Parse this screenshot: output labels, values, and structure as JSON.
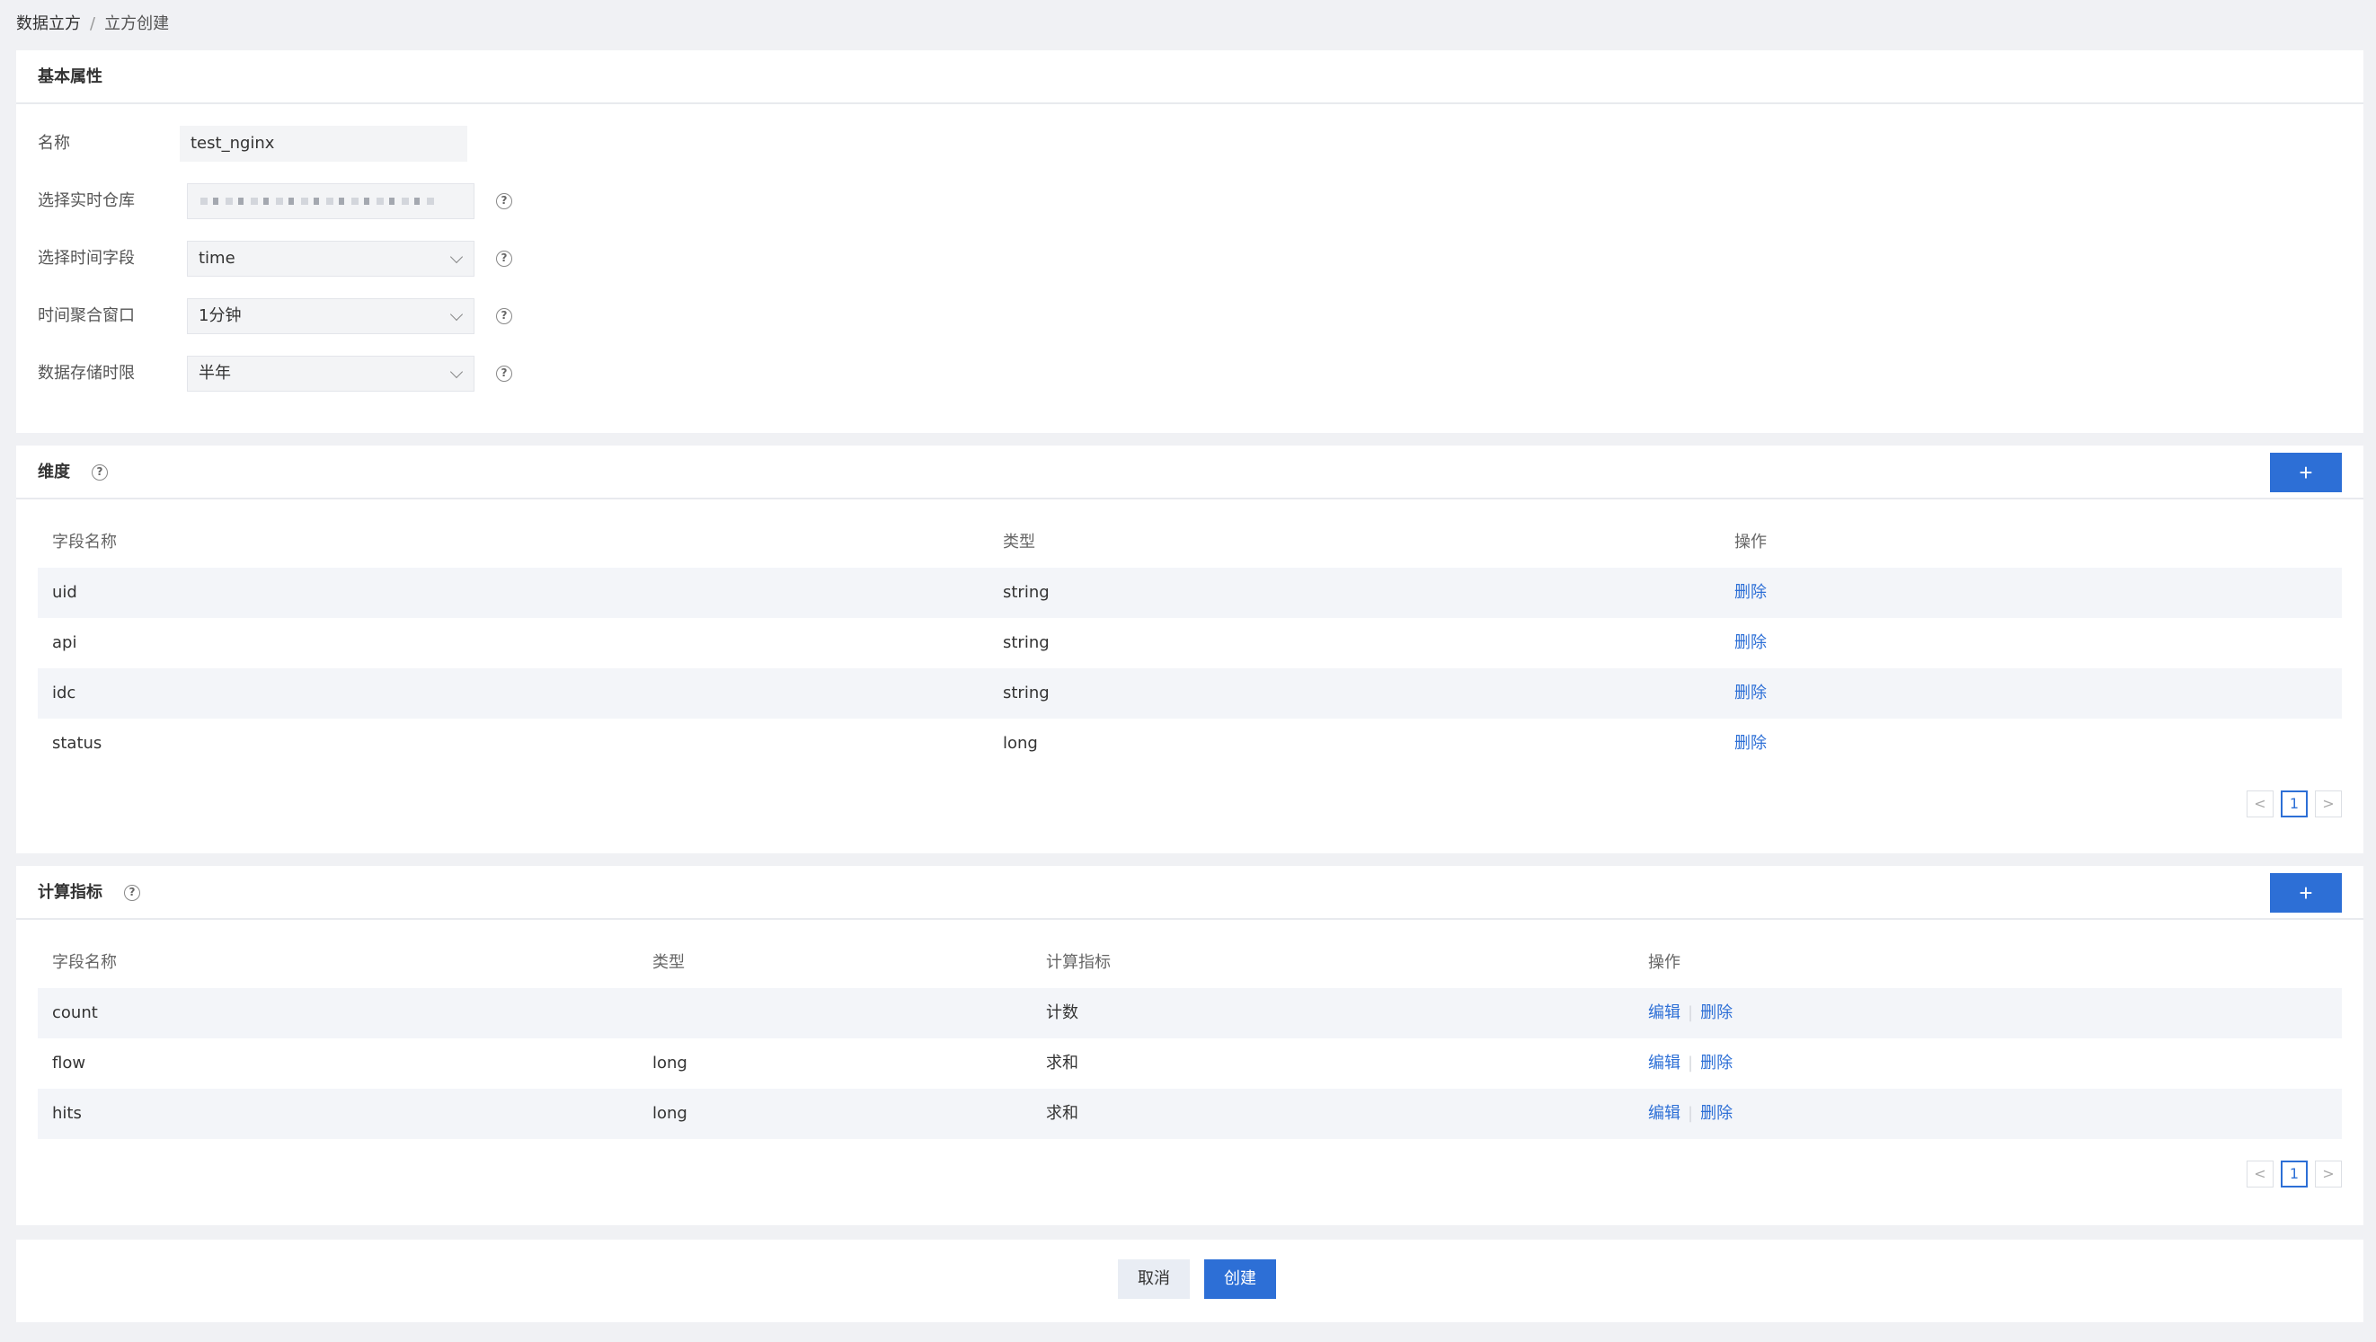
{
  "breadcrumb": {
    "root": "数据立方",
    "separator": "/",
    "current": "立方创建"
  },
  "basic": {
    "title": "基本属性",
    "name_label": "名称",
    "name_value": "test_nginx",
    "warehouse_label": "选择实时仓库",
    "time_field_label": "选择时间字段",
    "time_field_value": "time",
    "window_label": "时间聚合窗口",
    "window_value": "1分钟",
    "retention_label": "数据存储时限",
    "retention_value": "半年",
    "help_glyph": "?"
  },
  "dimensions": {
    "title": "维度",
    "add_label": "+",
    "columns": [
      "字段名称",
      "类型",
      "操作"
    ],
    "rows": [
      {
        "name": "uid",
        "type": "string",
        "action": "删除"
      },
      {
        "name": "api",
        "type": "string",
        "action": "删除"
      },
      {
        "name": "idc",
        "type": "string",
        "action": "删除"
      },
      {
        "name": "status",
        "type": "long",
        "action": "删除"
      }
    ],
    "pager": {
      "prev": "<",
      "page": "1",
      "next": ">"
    }
  },
  "metrics": {
    "title": "计算指标",
    "add_label": "+",
    "columns": [
      "字段名称",
      "类型",
      "计算指标",
      "操作"
    ],
    "rows": [
      {
        "name": "count",
        "type": "",
        "metric": "计数",
        "edit": "编辑",
        "delete": "删除"
      },
      {
        "name": "flow",
        "type": "long",
        "metric": "求和",
        "edit": "编辑",
        "delete": "删除"
      },
      {
        "name": "hits",
        "type": "long",
        "metric": "求和",
        "edit": "编辑",
        "delete": "删除"
      }
    ],
    "pager": {
      "prev": "<",
      "page": "1",
      "next": ">"
    }
  },
  "footer": {
    "cancel_label": "取消",
    "create_label": "创建"
  },
  "colors": {
    "accent": "#2d6fd6",
    "background": "#f0f1f4",
    "stripe": "#f3f5f9"
  }
}
